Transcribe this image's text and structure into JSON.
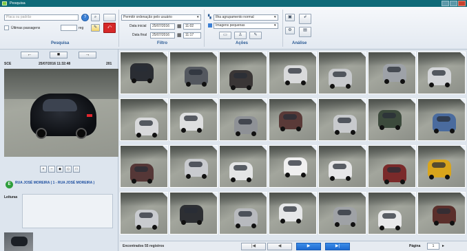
{
  "window": {
    "title": "Pesquisa"
  },
  "colors": {
    "title_bar": "#0f6a78",
    "accent_blue": "#2b5a94",
    "active_page": "#1d6ad0",
    "location_badge": "#2e9e3b",
    "clear_button": "#d62828"
  },
  "toolbar": {
    "search_group": {
      "plate_placeholder": "Placa ou padrão",
      "last_passages_label": "Últimas passagens",
      "last_passages_value": "",
      "last_passages_unit": "reg",
      "group_label": "Pesquisa",
      "icons": [
        "help-icon",
        "search-icon",
        "blank-icon",
        "edit-icon",
        "clear-icon"
      ]
    },
    "filter_group": {
      "sort_select": "Permitir ordenação pelo usuário",
      "start_date_label": "Data inicial",
      "start_date": "25/07/2016",
      "start_time": "11:02",
      "end_date_label": "Data final",
      "end_date": "25/07/2016",
      "end_time": "11:17",
      "group_label": "Filtro"
    },
    "actions_group": {
      "grouping_select": "Ilha agrupamento normal",
      "image_size_select": "Imagens pequenas",
      "group_label": "Ações",
      "icons": [
        "photo-icon",
        "user-icon",
        "edit-icon"
      ]
    },
    "analysis_group": {
      "group_label": "Análise",
      "icons": [
        "monitor-icon",
        "edit-icon",
        "gear-icon",
        "list-icon"
      ]
    }
  },
  "left_panel": {
    "nav": [
      "←",
      "■",
      "→"
    ],
    "capture_id": "SCE",
    "capture_time": "25/07/2016 11:32:48",
    "capture_number": "201",
    "mini_tools": [
      "+",
      "–",
      "◆",
      "◇",
      "□"
    ],
    "location_badge": "E",
    "location_text": "RUA JOSÉ MOREIRA ( 1 - RUA JOSÉ MOREIRA )",
    "readings_label": "Leituras"
  },
  "thumbnails": [
    {
      "vehicle": "#2a2d33"
    },
    {
      "vehicle": "#54585f"
    },
    {
      "vehicle": "#3a3636"
    },
    {
      "vehicle": "#d9dadb"
    },
    {
      "vehicle": "#c7c9cc"
    },
    {
      "vehicle": "#9ea2a8"
    },
    {
      "vehicle": "#d3d5d8"
    },
    {
      "vehicle": "#d8d9db"
    },
    {
      "vehicle": "#dedfe0"
    },
    {
      "vehicle": "#8e9196"
    },
    {
      "vehicle": "#5a3a38"
    },
    {
      "vehicle": "#c8cacd"
    },
    {
      "vehicle": "#3c4a3c"
    },
    {
      "vehicle": "#4a6b9e"
    },
    {
      "vehicle": "#553737"
    },
    {
      "vehicle": "#c9cbcf"
    },
    {
      "vehicle": "#e4e5e6"
    },
    {
      "vehicle": "#f0f0f0"
    },
    {
      "vehicle": "#e7e7e8"
    },
    {
      "vehicle": "#7a2a2a"
    },
    {
      "vehicle": "#d9a51c"
    },
    {
      "vehicle": "#c9cbcf"
    },
    {
      "vehicle": "#2d2f33"
    },
    {
      "vehicle": "#b8babe"
    },
    {
      "vehicle": "#e6e7e8"
    },
    {
      "vehicle": "#9fa2a6"
    },
    {
      "vehicle": "#e9e9ea"
    },
    {
      "vehicle": "#5b2f2b"
    }
  ],
  "status": {
    "records_text": "Encontrados 55 registros",
    "pagination": [
      {
        "label": "|◀",
        "active": false
      },
      {
        "label": "◀",
        "active": false
      },
      {
        "label": "▶",
        "active": true
      },
      {
        "label": "▶|",
        "active": true
      }
    ],
    "page_label": "Página",
    "page_value": "1",
    "page_arrow": "▸"
  }
}
